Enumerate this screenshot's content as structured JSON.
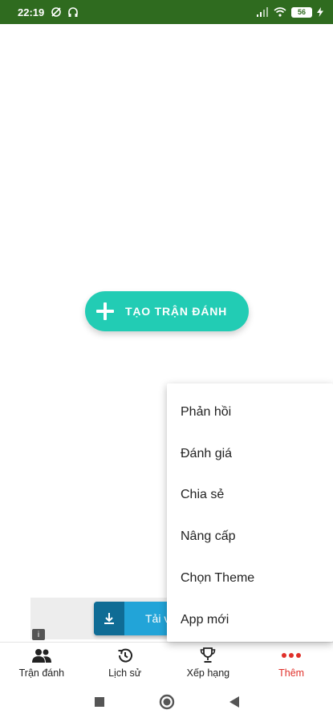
{
  "status_bar": {
    "time": "22:19",
    "battery": "56"
  },
  "main": {
    "create_button_label": "TẠO TRẬN ĐÁNH"
  },
  "ad": {
    "download_text": "Tải v"
  },
  "menu": {
    "items": [
      {
        "label": "Phản hồi"
      },
      {
        "label": "Đánh giá"
      },
      {
        "label": "Chia sẻ"
      },
      {
        "label": "Nâng cấp"
      },
      {
        "label": "Chọn Theme"
      },
      {
        "label": "App mới"
      }
    ]
  },
  "bottom_nav": {
    "tabs": [
      {
        "label": "Trận đánh",
        "icon": "people-icon"
      },
      {
        "label": "Lịch sử",
        "icon": "history-icon"
      },
      {
        "label": "Xếp hạng",
        "icon": "trophy-icon"
      },
      {
        "label": "Thêm",
        "icon": "more-dots-icon",
        "active": true
      }
    ]
  },
  "colors": {
    "status_bar": "#2f6b1f",
    "accent": "#22ccb4",
    "active_tab": "#e0302a"
  }
}
